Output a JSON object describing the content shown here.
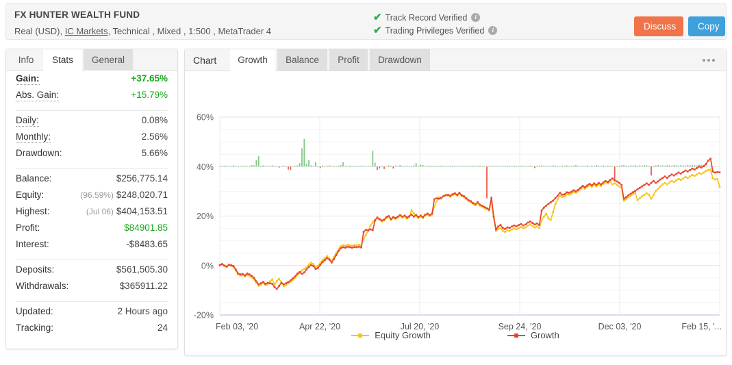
{
  "header": {
    "title": "FX HUNTER WEALTH FUND",
    "subtitle_parts": {
      "account": "Real (USD),",
      "broker": "IC Markets",
      "rest": ", Technical , Mixed , 1:500 , MetaTrader 4"
    },
    "verifications": [
      {
        "label": "Track Record Verified",
        "icon": "check-icon",
        "info": "i"
      },
      {
        "label": "Trading Privileges Verified",
        "icon": "check-icon",
        "info": "i"
      }
    ],
    "buttons": {
      "discuss": "Discuss",
      "copy": "Copy"
    },
    "colors": {
      "discuss_bg": "#f0734a",
      "copy_bg": "#3fa0dc",
      "verified_check": "#2eae4e"
    }
  },
  "left_panel": {
    "tabs": [
      {
        "label": "Info",
        "active": false
      },
      {
        "label": "Stats",
        "active": true
      },
      {
        "label": "General",
        "active": false
      }
    ],
    "groups": [
      {
        "rows": [
          {
            "label": "Gain:",
            "value": "+37.65%",
            "style": "greenb",
            "label_style": "bold dot"
          },
          {
            "label": "Abs. Gain:",
            "value": "+15.79%",
            "style": "green",
            "label_style": "dot"
          }
        ]
      },
      {
        "rows": [
          {
            "label": "Daily:",
            "value": "0.08%",
            "style": "",
            "label_style": "dot"
          },
          {
            "label": "Monthly:",
            "value": "2.56%",
            "style": "",
            "label_style": "dot"
          },
          {
            "label": "Drawdown:",
            "value": "5.66%",
            "style": "",
            "label_style": ""
          }
        ]
      },
      {
        "rows": [
          {
            "label": "Balance:",
            "value": "$256,775.14",
            "style": "",
            "label_style": ""
          },
          {
            "label": "Equity:",
            "value": "$248,020.71",
            "sub": "(96.59%)",
            "style": "",
            "label_style": ""
          },
          {
            "label": "Highest:",
            "value": "$404,153.51",
            "sub": "(Jul 06)",
            "style": "",
            "label_style": ""
          },
          {
            "label": "Profit:",
            "value": "$84901.85",
            "style": "green",
            "label_style": ""
          },
          {
            "label": "Interest:",
            "value": "-$8483.65",
            "style": "",
            "label_style": ""
          }
        ]
      },
      {
        "rows": [
          {
            "label": "Deposits:",
            "value": "$561,505.30",
            "style": "",
            "label_style": ""
          },
          {
            "label": "Withdrawals:",
            "value": "$365911.22",
            "style": "",
            "label_style": ""
          }
        ]
      },
      {
        "rows": [
          {
            "label": "Updated:",
            "value": "2 Hours ago",
            "style": "",
            "label_style": ""
          },
          {
            "label": "Tracking:",
            "value": "24",
            "style": "",
            "label_style": ""
          }
        ]
      }
    ]
  },
  "right_panel": {
    "title": "Chart",
    "tabs": [
      {
        "label": "Growth",
        "active": true
      },
      {
        "label": "Balance",
        "active": false
      },
      {
        "label": "Profit",
        "active": false
      },
      {
        "label": "Drawdown",
        "active": false
      }
    ],
    "menu_icon": "more-horizontal-icon"
  },
  "chart_data": {
    "type": "line",
    "title": "Growth",
    "xlabel": "",
    "ylabel": "",
    "ylim": [
      -20,
      60
    ],
    "yticks": [
      -20,
      0,
      20,
      40,
      60
    ],
    "ytick_labels": [
      "-20%",
      "0%",
      "20%",
      "40%",
      "60%"
    ],
    "xtick_labels": [
      "Feb 03, '20",
      "Apr 22, '20",
      "Jul 20, '20",
      "Sep 24, '20",
      "Dec 03, '20",
      "Feb 15, '..."
    ],
    "grid": true,
    "legend_position": "bottom",
    "colors": {
      "equity_growth": "#f5c518",
      "growth": "#e8442e",
      "bar_up": "#6ec077",
      "bar_down": "#e8442e"
    },
    "bar_baseline": 40,
    "series": [
      {
        "name": "Growth",
        "color": "#e8442e",
        "values": [
          0.2,
          0.6,
          0.0,
          -0.4,
          0.3,
          0.1,
          -0.2,
          -1.6,
          -3.2,
          -3.6,
          -3.4,
          -4.0,
          -3.2,
          -3.6,
          -4.2,
          -5.0,
          -6.4,
          -7.6,
          -7.2,
          -6.6,
          -7.4,
          -7.0,
          -7.2,
          -7.4,
          -8.8,
          -9.4,
          -8.2,
          -7.0,
          -7.6,
          -7.2,
          -6.6,
          -6.0,
          -5.2,
          -4.4,
          -3.2,
          -2.6,
          -3.4,
          -2.8,
          -1.6,
          -0.6,
          0.2,
          -0.2,
          -1.4,
          -1.0,
          0.2,
          1.4,
          2.2,
          3.0,
          2.4,
          1.2,
          2.6,
          4.2,
          5.8,
          7.0,
          7.4,
          7.2,
          7.6,
          7.4,
          7.2,
          7.5,
          7.4,
          7.6,
          7.3,
          13.6,
          14.4,
          14.2,
          14.6,
          14.3,
          18.2,
          19.4,
          18.8,
          18.2,
          18.6,
          19.6,
          20.0,
          18.8,
          19.6,
          19.2,
          19.8,
          20.4,
          19.8,
          20.2,
          19.4,
          19.9,
          20.6,
          19.8,
          20.4,
          19.6,
          20.2,
          19.6,
          20.6,
          21.0,
          20.4,
          21.0,
          26.8,
          27.2,
          27.0,
          27.4,
          28.0,
          28.4,
          28.6,
          28.2,
          28.8,
          29.2,
          28.6,
          29.4,
          28.4,
          28.0,
          27.2,
          26.4,
          26.0,
          25.2,
          24.8,
          25.6,
          24.6,
          24.2,
          23.6,
          23.2,
          22.6,
          27.4,
          19.8,
          14.6,
          15.8,
          16.4,
          15.2,
          14.8,
          15.4,
          15.2,
          15.8,
          16.2,
          15.8,
          16.4,
          16.8,
          16.2,
          16.6,
          17.4,
          17.8,
          17.2,
          16.6,
          17.0,
          16.4,
          22.2,
          23.4,
          24.2,
          25.0,
          25.6,
          26.2,
          27.2,
          28.2,
          29.4,
          28.6,
          28.8,
          29.6,
          29.4,
          29.8,
          30.4,
          30.0,
          30.6,
          31.4,
          32.2,
          31.6,
          32.4,
          33.0,
          32.4,
          33.2,
          32.6,
          33.4,
          32.8,
          33.6,
          34.2,
          33.8,
          34.6,
          35.2,
          34.4,
          34.0,
          33.4,
          32.6,
          27.0,
          27.6,
          28.4,
          29.0,
          29.6,
          30.2,
          30.8,
          31.4,
          32.0,
          32.6,
          33.2,
          32.6,
          33.4,
          34.2,
          33.4,
          34.0,
          34.8,
          35.4,
          36.0,
          35.4,
          36.2,
          36.8,
          36.4,
          37.0,
          37.6,
          37.2,
          37.8,
          38.4,
          38.0,
          38.6,
          39.2,
          38.8,
          39.4,
          40.0,
          39.6,
          40.2,
          41.0,
          42.4,
          43.2,
          38.0,
          37.6,
          37.8,
          37.65
        ]
      },
      {
        "name": "Equity Growth",
        "color": "#f5c518",
        "values": [
          0.0,
          0.4,
          -0.2,
          -0.6,
          0.1,
          -0.1,
          -0.6,
          -2.0,
          -3.6,
          -4.0,
          -3.8,
          -4.4,
          -3.8,
          -4.2,
          -4.8,
          -5.6,
          -7.0,
          -8.2,
          -7.8,
          -7.0,
          -8.0,
          -7.6,
          -6.4,
          -5.6,
          -7.8,
          -6.2,
          -5.4,
          -6.8,
          -8.4,
          -8.0,
          -7.2,
          -6.6,
          -5.8,
          -5.0,
          -3.8,
          -3.0,
          -2.0,
          -1.4,
          -0.8,
          0.4,
          1.2,
          0.6,
          -0.6,
          -0.2,
          1.0,
          2.2,
          3.0,
          3.8,
          3.0,
          1.8,
          3.4,
          5.0,
          6.6,
          7.8,
          8.2,
          8.0,
          8.4,
          8.2,
          8.0,
          8.3,
          8.2,
          8.4,
          8.1,
          10.6,
          12.4,
          14.0,
          16.2,
          17.4,
          18.6,
          19.2,
          18.4,
          17.8,
          18.2,
          19.2,
          19.6,
          18.4,
          19.2,
          18.8,
          19.4,
          20.0,
          19.4,
          19.8,
          19.0,
          19.5,
          22.4,
          21.0,
          20.0,
          19.2,
          19.8,
          19.2,
          20.2,
          20.6,
          20.0,
          20.6,
          24.0,
          26.0,
          27.6,
          27.0,
          28.2,
          28.6,
          28.2,
          27.8,
          28.4,
          28.8,
          28.2,
          29.0,
          28.0,
          27.6,
          26.8,
          26.0,
          25.6,
          24.8,
          24.4,
          25.2,
          24.2,
          23.8,
          23.2,
          22.8,
          22.2,
          26.0,
          19.0,
          14.0,
          14.8,
          15.2,
          14.0,
          13.6,
          14.2,
          14.0,
          14.6,
          15.0,
          14.6,
          15.2,
          15.6,
          15.0,
          15.4,
          16.2,
          16.6,
          16.0,
          15.4,
          15.8,
          15.2,
          18.2,
          19.8,
          21.0,
          19.0,
          18.4,
          21.6,
          24.8,
          26.8,
          28.2,
          27.6,
          28.0,
          28.8,
          28.6,
          29.0,
          29.8,
          29.4,
          30.0,
          30.8,
          31.6,
          31.0,
          31.8,
          32.4,
          31.8,
          32.6,
          32.0,
          32.8,
          32.2,
          33.0,
          33.6,
          33.2,
          34.0,
          32.8,
          33.2,
          32.6,
          32.0,
          31.4,
          26.2,
          26.8,
          27.6,
          28.2,
          28.8,
          29.4,
          26.4,
          27.2,
          28.0,
          28.6,
          29.2,
          28.6,
          27.0,
          28.4,
          30.2,
          31.0,
          32.0,
          32.8,
          33.4,
          32.8,
          33.6,
          34.2,
          33.8,
          34.4,
          35.0,
          34.6,
          35.2,
          35.8,
          35.4,
          36.0,
          36.6,
          36.2,
          36.8,
          37.4,
          37.0,
          37.6,
          38.2,
          38.6,
          38.8,
          35.2,
          34.8,
          35.0,
          31.8
        ]
      }
    ],
    "bars": [
      0,
      0,
      0.4,
      0.3,
      0,
      0.2,
      0.5,
      0.3,
      0,
      0.2,
      0.4,
      0.3,
      0,
      0,
      0.6,
      0.5,
      2.6,
      4.2,
      0.3,
      0.5,
      0.2,
      0,
      0.3,
      0.5,
      0.2,
      0,
      -0.4,
      0.2,
      0.4,
      0,
      -1.2,
      -1.4,
      0,
      0.2,
      0.5,
      1.4,
      7.4,
      11.2,
      1.2,
      2.6,
      0.5,
      0.3,
      1.8,
      0.2,
      -0.6,
      0.4,
      0.2,
      0.3,
      0.5,
      0.2,
      0.3,
      0.2,
      0.4,
      0.6,
      1.8,
      0.3,
      0.2,
      0.4,
      0.2,
      0,
      0.3,
      0.2,
      0.4,
      0.2,
      0,
      0.3,
      0.2,
      6.4,
      1.6,
      -1.4,
      -0.8,
      0.3,
      -1.0,
      0.2,
      0.5,
      0.3,
      -0.8,
      0.4,
      0.2,
      0.6,
      0.3,
      0.2,
      0.4,
      0.3,
      0.2,
      0.5,
      1.4,
      0.3,
      0.8,
      0.6,
      0.2,
      0.3,
      0.4,
      0.2,
      0,
      0.3,
      0.2,
      0.4,
      0.2,
      0.3,
      0,
      0.2,
      0.4,
      0.3,
      0.2,
      0,
      0.3,
      0.4,
      0.2,
      0.3,
      0.2,
      0.4,
      0.3,
      0.2,
      0.4,
      0.3,
      0.2,
      -12.8,
      0.2,
      0.3,
      0.2,
      0.4,
      0.3,
      0.2,
      0.3,
      0.2,
      0.4,
      0.3,
      0.2,
      0.4,
      0.3,
      0.2,
      0.4,
      0.3,
      0.2,
      0.3,
      0.4,
      0.2,
      -0.6,
      0.3,
      0.4,
      0.5,
      0.3,
      0.4,
      0.2,
      0.3,
      0.5,
      0.4,
      0.3,
      0.2,
      0.4,
      0.3,
      0.5,
      0.2,
      0.3,
      0.4,
      0.6,
      0.3,
      0.2,
      0.4,
      0.3,
      0.5,
      0.2,
      0.4,
      0.3,
      0.6,
      0.4,
      0.3,
      0.5,
      0.2,
      0.4,
      0.3,
      0.2,
      -5.2,
      0.3,
      0.4,
      0.5,
      0.6,
      0.4,
      0.3,
      0.5,
      0.4,
      0.6,
      0.3,
      0.5,
      0.4,
      0.6,
      0.5,
      0.3,
      -3.6,
      0.4,
      0.5,
      0.6,
      0.4,
      0.5,
      0.3,
      0.6,
      0.5,
      0.4,
      0.6,
      0.5,
      0.4,
      0.6,
      0.5,
      0.4,
      0.6,
      0.5,
      0.7,
      0.6,
      0.5,
      0.8,
      0.6,
      0.5,
      0.4
    ],
    "legend": [
      {
        "name": "Equity Growth",
        "color": "#f5c518"
      },
      {
        "name": "Growth",
        "color": "#e8442e"
      }
    ]
  }
}
